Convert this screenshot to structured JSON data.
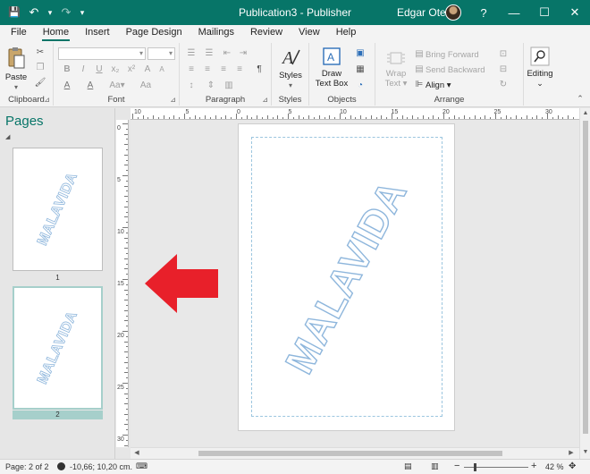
{
  "window": {
    "title": "Publication3 - Publisher",
    "user_name": "Edgar Otero",
    "help": "?",
    "minimize": "—",
    "restore": "☐",
    "close": "✕"
  },
  "qat": {
    "save_icon": "💾",
    "undo_icon": "↶",
    "undo_dd": "▾",
    "redo_icon": "↷",
    "customize_icon": "▾"
  },
  "tabs": [
    "File",
    "Home",
    "Insert",
    "Page Design",
    "Mailings",
    "Review",
    "View",
    "Help"
  ],
  "ribbon": {
    "clipboard": {
      "label": "Clipboard",
      "paste": "Paste"
    },
    "font": {
      "label": "Font",
      "bold": "B",
      "italic": "I",
      "underline": "U",
      "sub": "x₂",
      "sup": "x²",
      "clear": "Aa",
      "grow": "A",
      "shrink": "A",
      "color": "A",
      "highlight": "A",
      "case": "Aa▾"
    },
    "paragraph": {
      "label": "Paragraph",
      "pilcrow": "¶"
    },
    "styles": {
      "label": "Styles",
      "button": "Styles"
    },
    "objects": {
      "label": "Objects",
      "draw_line1": "Draw",
      "draw_line2": "Text Box"
    },
    "arrange": {
      "label": "Arrange",
      "wrap_line1": "Wrap",
      "wrap_line2": "Text ▾",
      "bring_forward": "Bring Forward",
      "send_backward": "Send Backward",
      "align": "Align ▾"
    },
    "editing": {
      "label": "Editing",
      "chevron": "⌄"
    }
  },
  "pages_pane": {
    "title": "Pages",
    "collapse": "◢",
    "thumbnails": [
      {
        "word": "MALAVIDA",
        "number": "1"
      },
      {
        "word": "MALAVIDA",
        "number": "2"
      }
    ]
  },
  "ruler_h": [
    "10",
    "5",
    "0",
    "5",
    "10",
    "15",
    "20",
    "25",
    "30",
    "35",
    "40"
  ],
  "ruler_v": [
    "0",
    "5",
    "10",
    "15",
    "20",
    "25",
    "30"
  ],
  "canvas": {
    "word": "MALAVIDA"
  },
  "status": {
    "page": "Page: 2 of 2",
    "position": "-10,66; 10,20 cm.",
    "zoom": "42 %",
    "zoom_minus": "−",
    "zoom_plus": "+"
  },
  "colors": {
    "accent": "#077568",
    "arrow": "#e8202a",
    "outline": "#8eb6dc"
  }
}
